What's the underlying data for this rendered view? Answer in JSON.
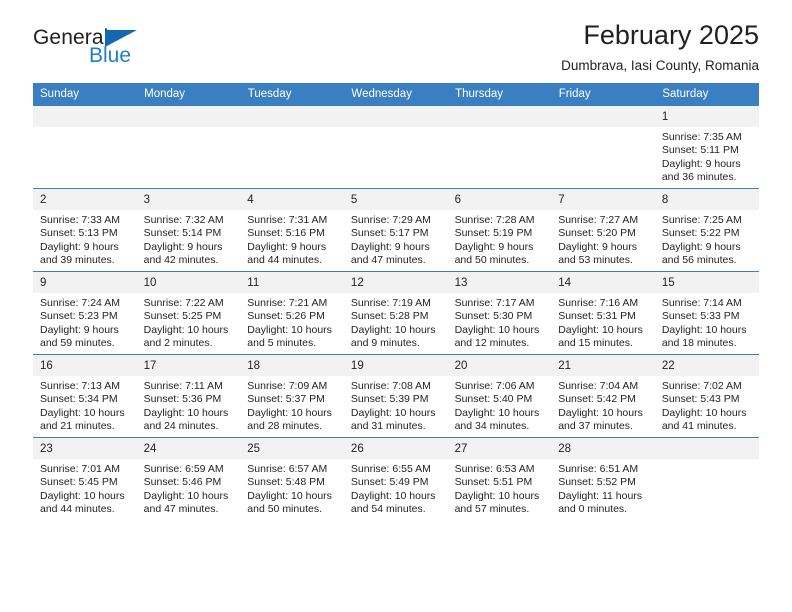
{
  "brand": {
    "word_one": "General",
    "word_two": "Blue",
    "triangle_icon": "triangle-icon",
    "accent_color": "#1268b3",
    "blue_text_color": "#1f7fc4"
  },
  "header": {
    "title": "February 2025",
    "subtitle": "Dumbrava, Iasi County, Romania"
  },
  "calendar": {
    "header_bg": "#3a7fc1",
    "daynum_bg": "#f2f2f2",
    "weekdays": [
      "Sunday",
      "Monday",
      "Tuesday",
      "Wednesday",
      "Thursday",
      "Friday",
      "Saturday"
    ],
    "weeks": [
      [
        {
          "day": "",
          "sunrise": "",
          "sunset": "",
          "daylight1": "",
          "daylight2": ""
        },
        {
          "day": "",
          "sunrise": "",
          "sunset": "",
          "daylight1": "",
          "daylight2": ""
        },
        {
          "day": "",
          "sunrise": "",
          "sunset": "",
          "daylight1": "",
          "daylight2": ""
        },
        {
          "day": "",
          "sunrise": "",
          "sunset": "",
          "daylight1": "",
          "daylight2": ""
        },
        {
          "day": "",
          "sunrise": "",
          "sunset": "",
          "daylight1": "",
          "daylight2": ""
        },
        {
          "day": "",
          "sunrise": "",
          "sunset": "",
          "daylight1": "",
          "daylight2": ""
        },
        {
          "day": "1",
          "sunrise": "Sunrise: 7:35 AM",
          "sunset": "Sunset: 5:11 PM",
          "daylight1": "Daylight: 9 hours",
          "daylight2": "and 36 minutes."
        }
      ],
      [
        {
          "day": "2",
          "sunrise": "Sunrise: 7:33 AM",
          "sunset": "Sunset: 5:13 PM",
          "daylight1": "Daylight: 9 hours",
          "daylight2": "and 39 minutes."
        },
        {
          "day": "3",
          "sunrise": "Sunrise: 7:32 AM",
          "sunset": "Sunset: 5:14 PM",
          "daylight1": "Daylight: 9 hours",
          "daylight2": "and 42 minutes."
        },
        {
          "day": "4",
          "sunrise": "Sunrise: 7:31 AM",
          "sunset": "Sunset: 5:16 PM",
          "daylight1": "Daylight: 9 hours",
          "daylight2": "and 44 minutes."
        },
        {
          "day": "5",
          "sunrise": "Sunrise: 7:29 AM",
          "sunset": "Sunset: 5:17 PM",
          "daylight1": "Daylight: 9 hours",
          "daylight2": "and 47 minutes."
        },
        {
          "day": "6",
          "sunrise": "Sunrise: 7:28 AM",
          "sunset": "Sunset: 5:19 PM",
          "daylight1": "Daylight: 9 hours",
          "daylight2": "and 50 minutes."
        },
        {
          "day": "7",
          "sunrise": "Sunrise: 7:27 AM",
          "sunset": "Sunset: 5:20 PM",
          "daylight1": "Daylight: 9 hours",
          "daylight2": "and 53 minutes."
        },
        {
          "day": "8",
          "sunrise": "Sunrise: 7:25 AM",
          "sunset": "Sunset: 5:22 PM",
          "daylight1": "Daylight: 9 hours",
          "daylight2": "and 56 minutes."
        }
      ],
      [
        {
          "day": "9",
          "sunrise": "Sunrise: 7:24 AM",
          "sunset": "Sunset: 5:23 PM",
          "daylight1": "Daylight: 9 hours",
          "daylight2": "and 59 minutes."
        },
        {
          "day": "10",
          "sunrise": "Sunrise: 7:22 AM",
          "sunset": "Sunset: 5:25 PM",
          "daylight1": "Daylight: 10 hours",
          "daylight2": "and 2 minutes."
        },
        {
          "day": "11",
          "sunrise": "Sunrise: 7:21 AM",
          "sunset": "Sunset: 5:26 PM",
          "daylight1": "Daylight: 10 hours",
          "daylight2": "and 5 minutes."
        },
        {
          "day": "12",
          "sunrise": "Sunrise: 7:19 AM",
          "sunset": "Sunset: 5:28 PM",
          "daylight1": "Daylight: 10 hours",
          "daylight2": "and 9 minutes."
        },
        {
          "day": "13",
          "sunrise": "Sunrise: 7:17 AM",
          "sunset": "Sunset: 5:30 PM",
          "daylight1": "Daylight: 10 hours",
          "daylight2": "and 12 minutes."
        },
        {
          "day": "14",
          "sunrise": "Sunrise: 7:16 AM",
          "sunset": "Sunset: 5:31 PM",
          "daylight1": "Daylight: 10 hours",
          "daylight2": "and 15 minutes."
        },
        {
          "day": "15",
          "sunrise": "Sunrise: 7:14 AM",
          "sunset": "Sunset: 5:33 PM",
          "daylight1": "Daylight: 10 hours",
          "daylight2": "and 18 minutes."
        }
      ],
      [
        {
          "day": "16",
          "sunrise": "Sunrise: 7:13 AM",
          "sunset": "Sunset: 5:34 PM",
          "daylight1": "Daylight: 10 hours",
          "daylight2": "and 21 minutes."
        },
        {
          "day": "17",
          "sunrise": "Sunrise: 7:11 AM",
          "sunset": "Sunset: 5:36 PM",
          "daylight1": "Daylight: 10 hours",
          "daylight2": "and 24 minutes."
        },
        {
          "day": "18",
          "sunrise": "Sunrise: 7:09 AM",
          "sunset": "Sunset: 5:37 PM",
          "daylight1": "Daylight: 10 hours",
          "daylight2": "and 28 minutes."
        },
        {
          "day": "19",
          "sunrise": "Sunrise: 7:08 AM",
          "sunset": "Sunset: 5:39 PM",
          "daylight1": "Daylight: 10 hours",
          "daylight2": "and 31 minutes."
        },
        {
          "day": "20",
          "sunrise": "Sunrise: 7:06 AM",
          "sunset": "Sunset: 5:40 PM",
          "daylight1": "Daylight: 10 hours",
          "daylight2": "and 34 minutes."
        },
        {
          "day": "21",
          "sunrise": "Sunrise: 7:04 AM",
          "sunset": "Sunset: 5:42 PM",
          "daylight1": "Daylight: 10 hours",
          "daylight2": "and 37 minutes."
        },
        {
          "day": "22",
          "sunrise": "Sunrise: 7:02 AM",
          "sunset": "Sunset: 5:43 PM",
          "daylight1": "Daylight: 10 hours",
          "daylight2": "and 41 minutes."
        }
      ],
      [
        {
          "day": "23",
          "sunrise": "Sunrise: 7:01 AM",
          "sunset": "Sunset: 5:45 PM",
          "daylight1": "Daylight: 10 hours",
          "daylight2": "and 44 minutes."
        },
        {
          "day": "24",
          "sunrise": "Sunrise: 6:59 AM",
          "sunset": "Sunset: 5:46 PM",
          "daylight1": "Daylight: 10 hours",
          "daylight2": "and 47 minutes."
        },
        {
          "day": "25",
          "sunrise": "Sunrise: 6:57 AM",
          "sunset": "Sunset: 5:48 PM",
          "daylight1": "Daylight: 10 hours",
          "daylight2": "and 50 minutes."
        },
        {
          "day": "26",
          "sunrise": "Sunrise: 6:55 AM",
          "sunset": "Sunset: 5:49 PM",
          "daylight1": "Daylight: 10 hours",
          "daylight2": "and 54 minutes."
        },
        {
          "day": "27",
          "sunrise": "Sunrise: 6:53 AM",
          "sunset": "Sunset: 5:51 PM",
          "daylight1": "Daylight: 10 hours",
          "daylight2": "and 57 minutes."
        },
        {
          "day": "28",
          "sunrise": "Sunrise: 6:51 AM",
          "sunset": "Sunset: 5:52 PM",
          "daylight1": "Daylight: 11 hours",
          "daylight2": "and 0 minutes."
        },
        {
          "day": "",
          "sunrise": "",
          "sunset": "",
          "daylight1": "",
          "daylight2": ""
        }
      ]
    ]
  }
}
